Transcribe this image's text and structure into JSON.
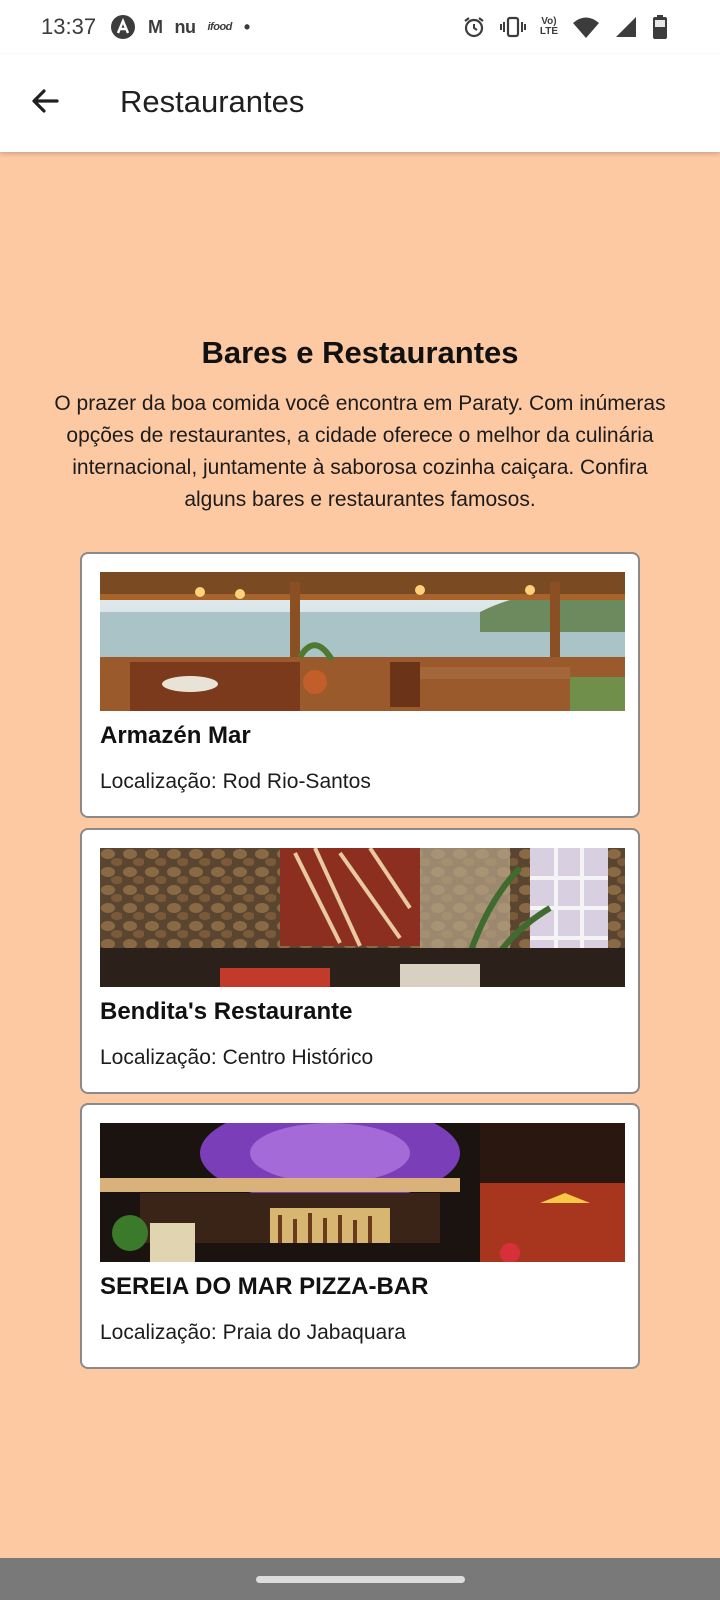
{
  "status_bar": {
    "time": "13:37",
    "left_icons": [
      "A",
      "M",
      "nu",
      "ifood",
      "•"
    ],
    "right_icons": [
      "alarm-icon",
      "vibrate-icon",
      "volte-icon",
      "wifi-icon",
      "signal-icon",
      "battery-icon"
    ],
    "volte_label": "Vo)",
    "lte_label": "LTE"
  },
  "app_bar": {
    "title": "Restaurantes",
    "back_icon": "arrow-back-icon"
  },
  "section": {
    "title": "Bares e Restaurantes",
    "intro": "O prazer da boa comida você encontra em Paraty. Com inúmeras opções de restaurantes, a cidade oferece o melhor da culinária internacional, juntamente à saborosa cozinha caiçara. Confira alguns bares e restaurantes famosos."
  },
  "restaurants": [
    {
      "name": "Armazén Mar",
      "location": "Localização: Rod Rio-Santos"
    },
    {
      "name": "Bendita's Restaurante",
      "location": "Localização: Centro Histórico"
    },
    {
      "name": "SEREIA DO MAR PIZZA-BAR",
      "location": "Localização: Praia do Jabaquara"
    }
  ],
  "colors": {
    "background": "#fdc9a3",
    "app_bar": "#ffffff",
    "card_border": "#8a8a8a",
    "nav_bar": "#797979"
  }
}
